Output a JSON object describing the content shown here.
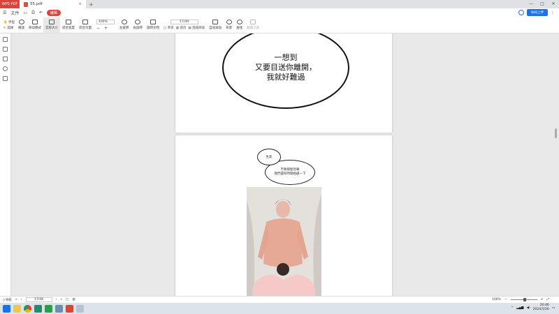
{
  "titlebar": {
    "app_label": "WPS PDF",
    "doc_tab": "55.pdf",
    "close_tab": "×",
    "new_tab": "+"
  },
  "menubar": {
    "file": "文件",
    "edit_pill": "编辑",
    "share_label": "协同上传"
  },
  "toolbar": {
    "hand": "手型",
    "select": "选择",
    "play": "播放",
    "read_mode": "阅读模式",
    "actual_size": "实际大小",
    "fit_width": "适合宽度",
    "fit_page": "适合页面",
    "zoom_value": "100%",
    "zoom_out": "−",
    "zoom_in": "+",
    "rotate_left": "左旋转",
    "rotate_right": "右旋转",
    "rotate_doc": "旋转文档",
    "page_value": "17/44",
    "single": "单页",
    "double": "双页",
    "continuous": "连续阅读",
    "auto_scroll": "自动滚动",
    "background": "背景",
    "search": "查找",
    "screen_capture": "截图工具"
  },
  "page1": {
    "line1": "一想到",
    "line2": "又要目送你離開，",
    "line3": "我就好難過"
  },
  "page2": {
    "small_bubble": "生氣",
    "big_bubble_line1": "不要那麼急嘛",
    "big_bubble_line2": "我們還有時間相處一下"
  },
  "statusbar": {
    "nav": "导航",
    "page_value": "17/44",
    "zoom_value": "100%"
  },
  "taskbar": {
    "time": "20:46",
    "date": "2024/1/26"
  }
}
